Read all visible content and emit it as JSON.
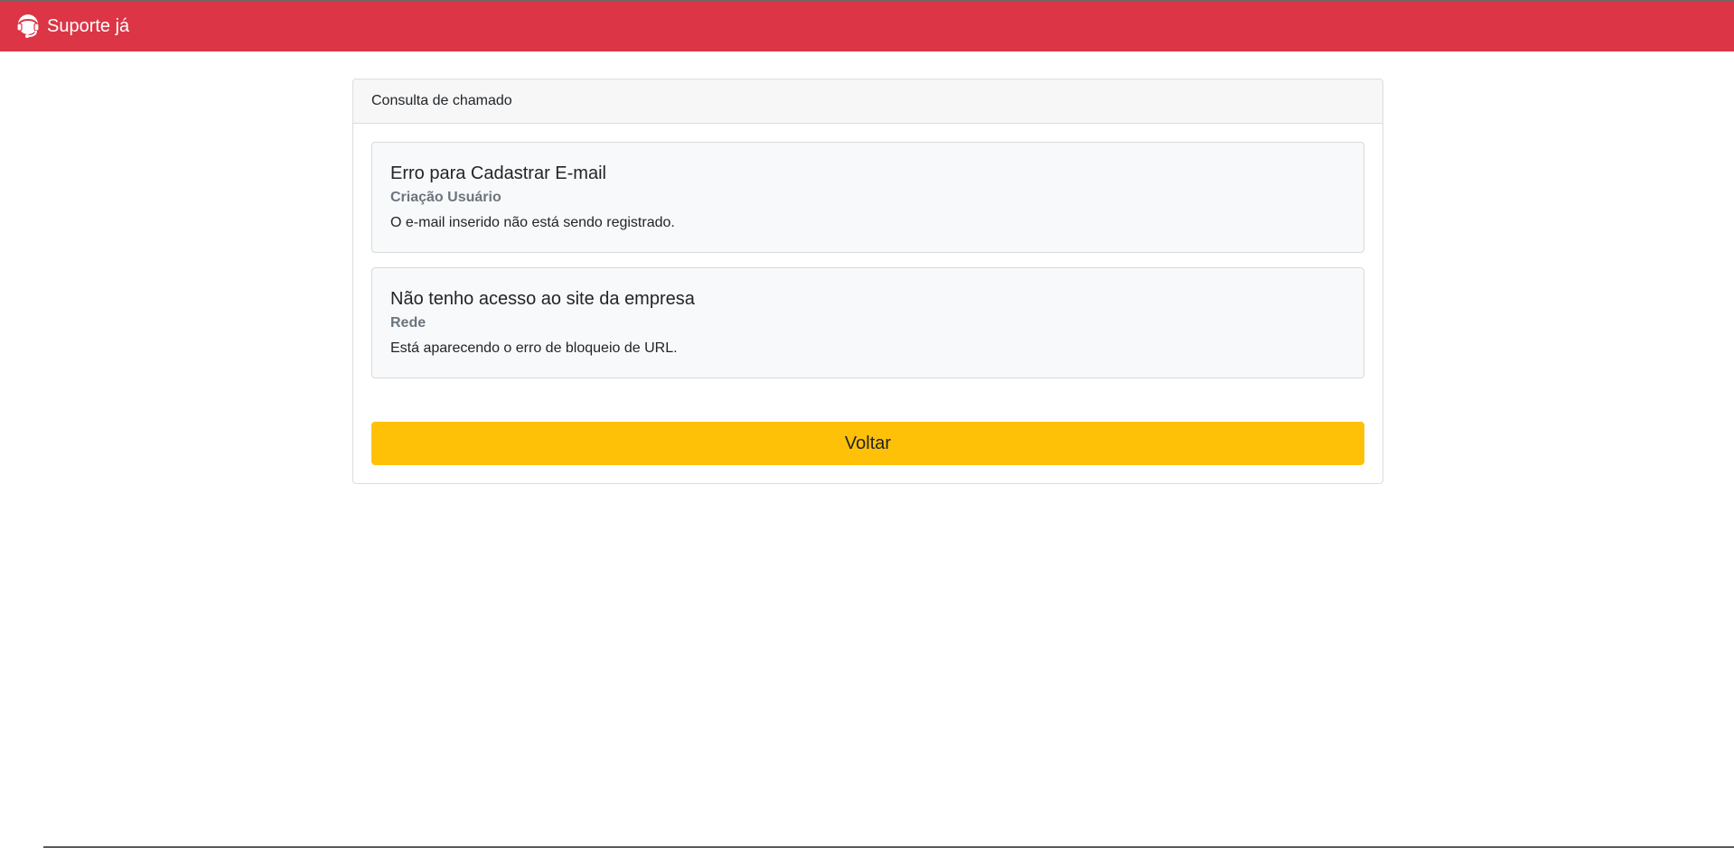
{
  "navbar": {
    "brand_text": "Suporte já",
    "brand_icon": "headset-icon",
    "background_color": "#dc3545"
  },
  "card": {
    "header_title": "Consulta de chamado"
  },
  "tickets": [
    {
      "title": "Erro para Cadastrar E-mail",
      "category": "Criação Usuário",
      "description": "O e-mail inserido não está sendo registrado."
    },
    {
      "title": "Não tenho acesso ao site da empresa",
      "category": "Rede",
      "description": "Está aparecendo o erro de bloqueio de URL."
    }
  ],
  "actions": {
    "back_label": "Voltar",
    "back_color": "#ffc107"
  }
}
